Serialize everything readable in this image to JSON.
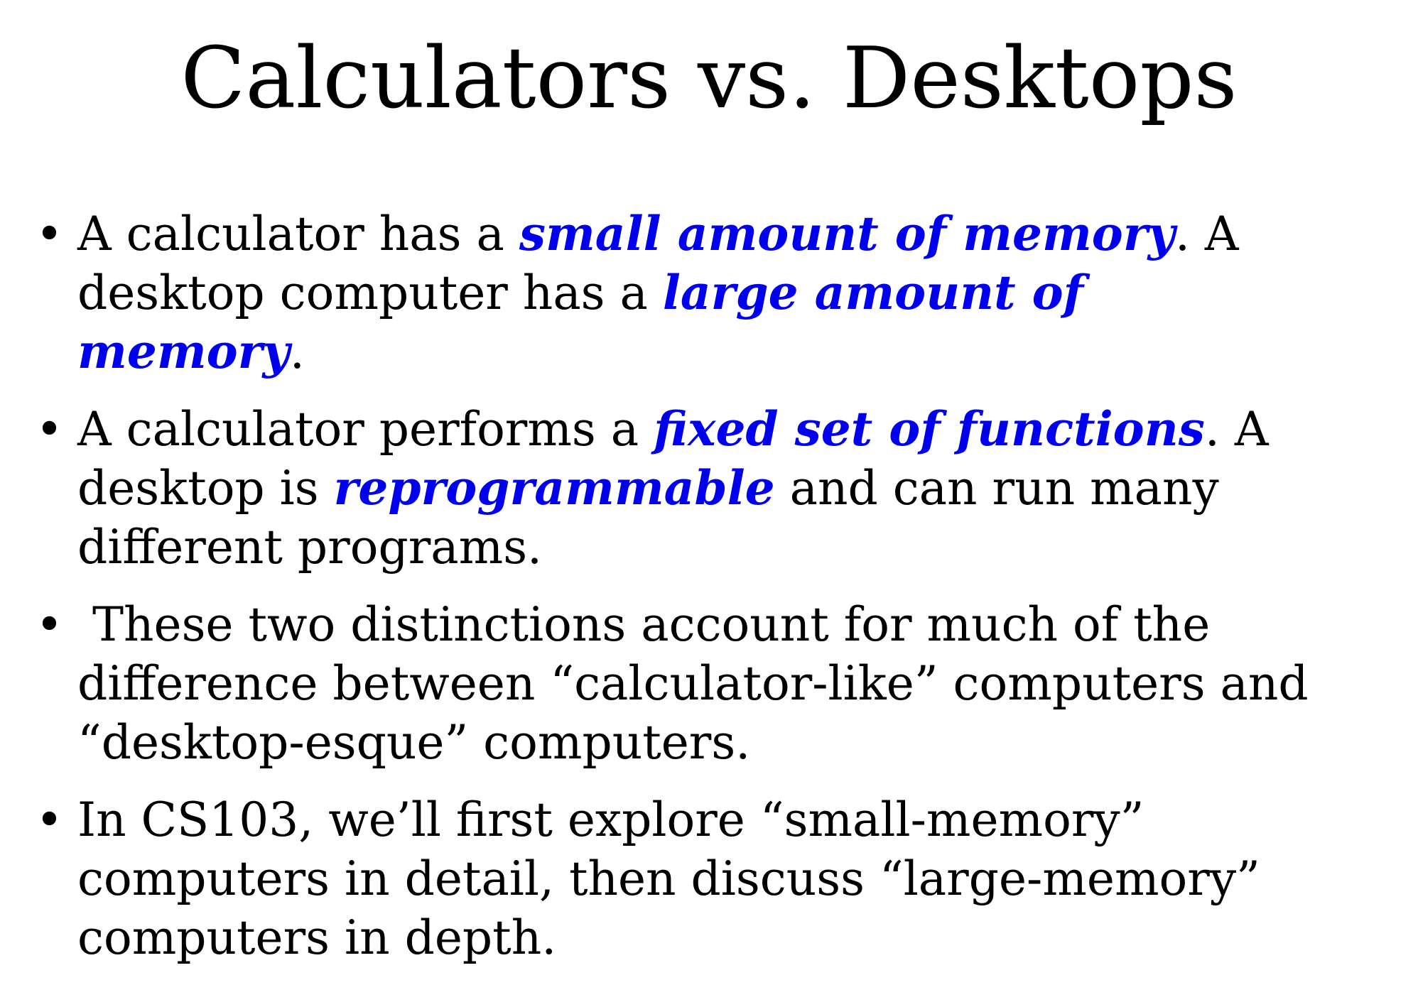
{
  "title": "Calculators vs. Desktops",
  "bullet_symbol": "•",
  "accent_color": "#0000ee",
  "bullets": [
    {
      "lines": [
        [
          {
            "text": "A calculator has a "
          },
          {
            "text": "small amount of memory",
            "em": true
          },
          {
            "text": ". A"
          }
        ],
        [
          {
            "text": "desktop computer has a "
          },
          {
            "text": "large amount of",
            "em": true
          }
        ],
        [
          {
            "text": "memory",
            "em": true
          },
          {
            "text": "."
          }
        ]
      ]
    },
    {
      "lines": [
        [
          {
            "text": "A calculator performs a "
          },
          {
            "text": "fixed set of functions",
            "em": true
          },
          {
            "text": ". A"
          }
        ],
        [
          {
            "text": "desktop is "
          },
          {
            "text": "reprogrammable",
            "em": true
          },
          {
            "text": " and can run many"
          }
        ],
        [
          {
            "text": "different programs."
          }
        ]
      ]
    },
    {
      "lines": [
        [
          {
            "text": " These two distinctions account for much of the"
          }
        ],
        [
          {
            "text": "difference between “calculator-like” computers and"
          }
        ],
        [
          {
            "text": "“desktop-esque” computers."
          }
        ]
      ]
    },
    {
      "lines": [
        [
          {
            "text": "In CS103, we’ll first explore “small-memory”"
          }
        ],
        [
          {
            "text": "computers in detail, then discuss “large-memory”"
          }
        ],
        [
          {
            "text": "computers in depth."
          }
        ]
      ]
    }
  ]
}
